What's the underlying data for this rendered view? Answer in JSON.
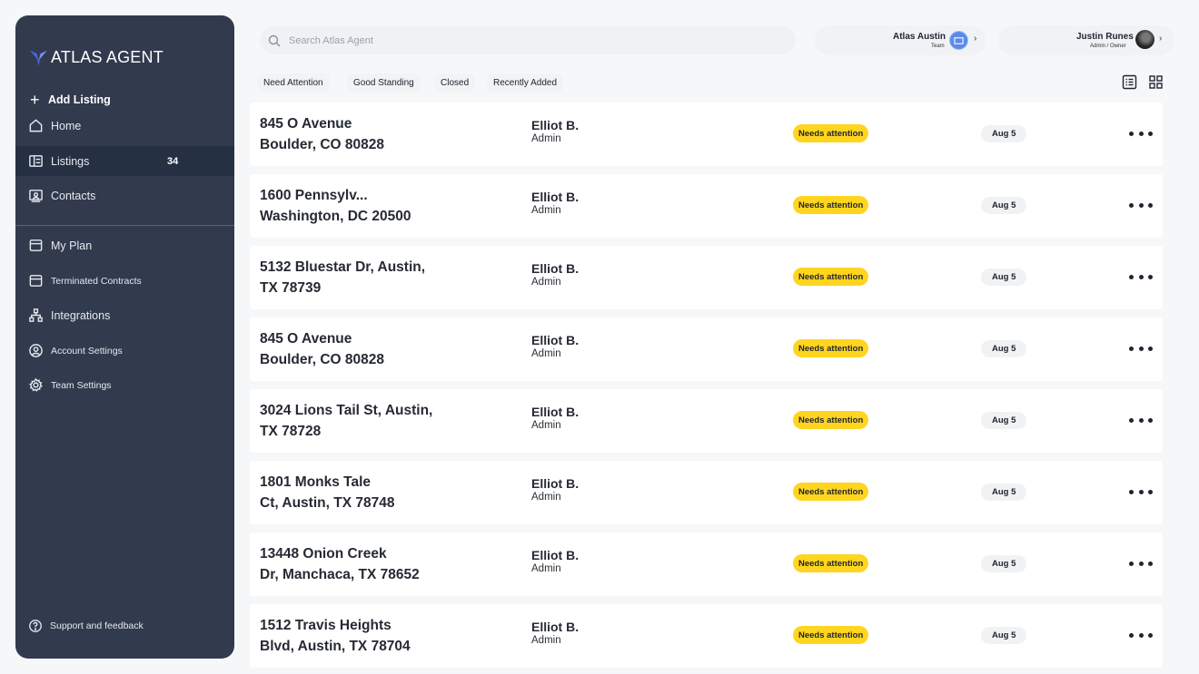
{
  "brand": {
    "name": "ATLAS AGENT",
    "accent": "#5b6cf0"
  },
  "sidebar": {
    "add_listing": "Add Listing",
    "items": [
      {
        "label": "Home",
        "icon": "home-icon"
      },
      {
        "label": "Listings",
        "icon": "listings-icon",
        "count": "34",
        "active": true
      },
      {
        "label": "Contacts",
        "icon": "contacts-icon"
      },
      {
        "label": "My Plan",
        "icon": "plan-icon"
      },
      {
        "label": "Terminated Contracts",
        "icon": "terminated-icon"
      },
      {
        "label": "Integrations",
        "icon": "integrations-icon"
      },
      {
        "label": "Account Settings",
        "icon": "account-icon"
      },
      {
        "label": "Team Settings",
        "icon": "gear-icon"
      }
    ],
    "support": "Support and feedback"
  },
  "search": {
    "placeholder": "Search Atlas Agent"
  },
  "team": {
    "name": "Atlas Austin",
    "role": "Team"
  },
  "user": {
    "name": "Justin Runes",
    "role": "Admin / Owner"
  },
  "filters": [
    "Need Attention",
    "Good Standing",
    "Closed",
    "Recently Added"
  ],
  "listings": [
    {
      "line1": "845 O Avenue",
      "line2": "Boulder, CO 80828",
      "agent": "Elliot B.",
      "role": "Admin",
      "status": "Needs attention",
      "date": "Aug 5"
    },
    {
      "line1": "1600 Pennsylv...",
      "line2": "Washington, DC 20500",
      "agent": "Elliot B.",
      "role": "Admin",
      "status": "Needs attention",
      "date": "Aug 5"
    },
    {
      "line1": "5132 Bluestar Dr, Austin,",
      "line2": "TX 78739",
      "agent": "Elliot B.",
      "role": "Admin",
      "status": "Needs attention",
      "date": "Aug 5"
    },
    {
      "line1": "845 O Avenue",
      "line2": "Boulder, CO 80828",
      "agent": "Elliot B.",
      "role": "Admin",
      "status": "Needs attention",
      "date": "Aug 5"
    },
    {
      "line1": "3024 Lions Tail St, Austin,",
      "line2": "TX 78728",
      "agent": "Elliot B.",
      "role": "Admin",
      "status": "Needs attention",
      "date": "Aug 5"
    },
    {
      "line1": "1801 Monks Tale",
      "line2": "Ct, Austin, TX 78748",
      "agent": "Elliot B.",
      "role": "Admin",
      "status": "Needs attention",
      "date": "Aug 5"
    },
    {
      "line1": "13448 Onion Creek",
      "line2": "Dr, Manchaca, TX 78652",
      "agent": "Elliot B.",
      "role": "Admin",
      "status": "Needs attention",
      "date": "Aug 5"
    },
    {
      "line1": "1512 Travis Heights",
      "line2": "Blvd, Austin, TX 78704",
      "agent": "Elliot B.",
      "role": "Admin",
      "status": "Needs attention",
      "date": "Aug 5"
    }
  ]
}
